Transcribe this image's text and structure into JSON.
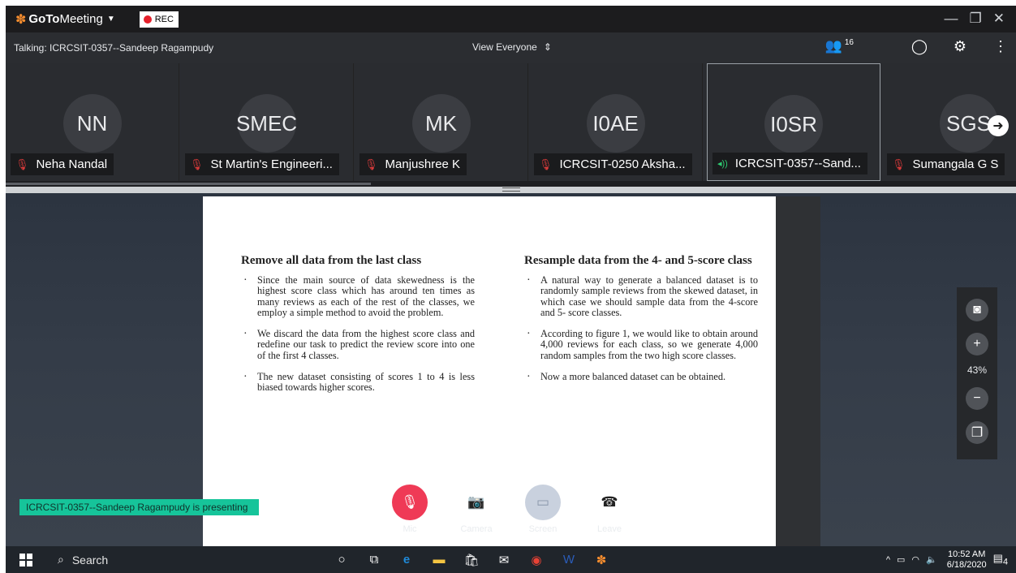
{
  "titlebar": {
    "app_name_bold": "GoTo",
    "app_name_rest": "Meeting",
    "rec_label": "REC",
    "window_controls": [
      "—",
      "❐",
      "✕"
    ]
  },
  "talkbar": {
    "talking_text": "Talking: ICRCSIT-0357--Sandeep Ragampudy",
    "view_label": "View Everyone",
    "participant_count": "16"
  },
  "participants": [
    {
      "initials": "NN",
      "name": "Neha Nandal",
      "status": "muted"
    },
    {
      "initials": "SMEC",
      "name": "St Martin's Engineeri...",
      "status": "muted"
    },
    {
      "initials": "MK",
      "name": "Manjushree K",
      "status": "muted"
    },
    {
      "initials": "I0AE",
      "name": "ICRCSIT-0250 Aksha...",
      "status": "muted"
    },
    {
      "initials": "I0SR",
      "name": "ICRCSIT-0357--Sand...",
      "status": "speaking",
      "active": true
    },
    {
      "initials": "SGS",
      "name": "Sumangala G S",
      "status": "muted"
    }
  ],
  "document": {
    "left": {
      "heading": "Remove all data from the last class",
      "bullets": [
        "Since the main source of data skewedness is the highest score class which has around ten times as many reviews as each of the rest of the classes, we employ a simple method to avoid the problem.",
        "We discard the data from the highest score class and redefine our task to predict the review score into one of the first 4 classes.",
        "The new dataset consisting of scores 1 to 4 is less biased towards higher scores."
      ]
    },
    "right": {
      "heading": "Resample data from the 4- and 5-score class",
      "bullets": [
        "A natural way to generate a balanced dataset is to randomly sample reviews from the skewed dataset, in which case we should sample data from the 4-score and 5- score classes.",
        "According to figure 1, we would like to obtain around 4,000 reviews for each class, so we generate 4,000 random samples from the two high score classes.",
        "Now a more balanced dataset can be obtained."
      ]
    }
  },
  "presenting_banner": "ICRCSIT-0357--Sandeep Ragampudy is presenting",
  "controls": {
    "mic": "Mic",
    "camera": "Camera",
    "screen": "Screen",
    "leave": "Leave"
  },
  "zoom": {
    "level": "43%"
  },
  "taskbar": {
    "search_label": "Search",
    "time": "10:52 AM",
    "date": "6/18/2020",
    "notification_count": "4"
  },
  "colors": {
    "mic_active": "#ef3a56",
    "presenting_banner": "#16c49a",
    "rec_dot": "#e5202b",
    "logo": "#f68d2e"
  }
}
